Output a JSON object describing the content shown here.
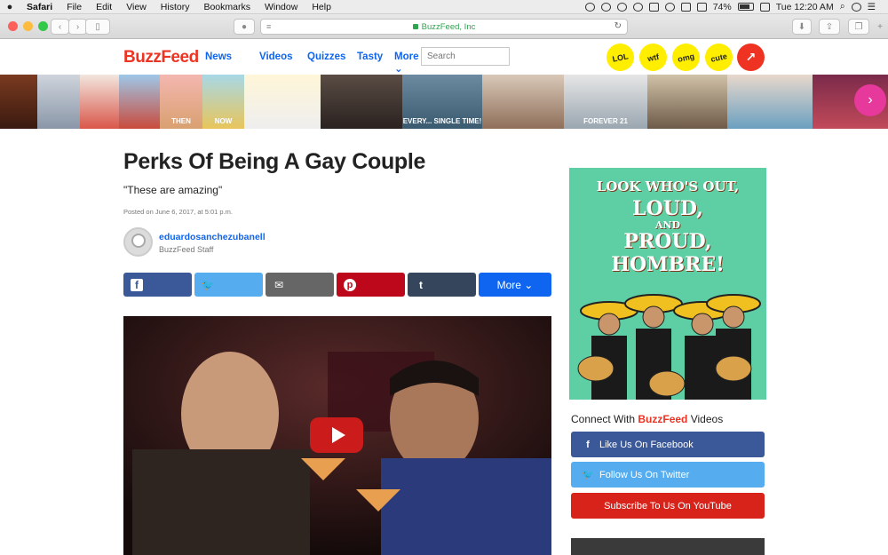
{
  "menubar": {
    "apple": "",
    "app": "Safari",
    "items": [
      "File",
      "Edit",
      "View",
      "History",
      "Bookmarks",
      "Window",
      "Help"
    ],
    "battery_percent": "74%",
    "clock": "Tue 12:20 AM"
  },
  "browser": {
    "url_text": "BuzzFeed, Inc"
  },
  "header": {
    "logo": "BuzzFeed",
    "nav": [
      "News",
      "Videos",
      "Quizzes",
      "Tasty",
      "More ⌄"
    ],
    "search_placeholder": "Search",
    "badges": [
      "LOL",
      "wtf",
      "omg",
      "cute"
    ]
  },
  "strip": {
    "captions": [
      "",
      "",
      "",
      "THEN",
      "NOW",
      "",
      "",
      "EVERY... SINGLE TIME!",
      "",
      "FOREVER 21",
      "",
      "",
      "",
      "",
      ""
    ]
  },
  "article": {
    "title": "Perks Of Being A Gay Couple",
    "dek": "\"These are amazing\"",
    "posted": "Posted on June 6, 2017, at 5:01 p.m.",
    "author": "eduardosanchezubanell",
    "role": "BuzzFeed Staff",
    "share_more": "More ⌄"
  },
  "sidebar": {
    "ad_lines": [
      "LOOK WHO'S OUT,",
      "LOUD,",
      "AND",
      "PROUD,",
      "HOMBRE!"
    ],
    "connect_prefix": "Connect With ",
    "connect_brand": "BuzzFeed",
    "connect_suffix": " Videos",
    "facebook": "Like Us On Facebook",
    "twitter": "Follow Us On Twitter",
    "youtube": "Subscribe To Us On YouTube"
  },
  "colors": {
    "brand_red": "#ee3322",
    "link_blue": "#0f65ef",
    "facebook": "#3b5998",
    "twitter": "#55acee",
    "email": "#666666",
    "pinterest": "#bd081c",
    "tumblr": "#35465c",
    "more": "#0f65ef",
    "youtube": "#d8231b"
  }
}
